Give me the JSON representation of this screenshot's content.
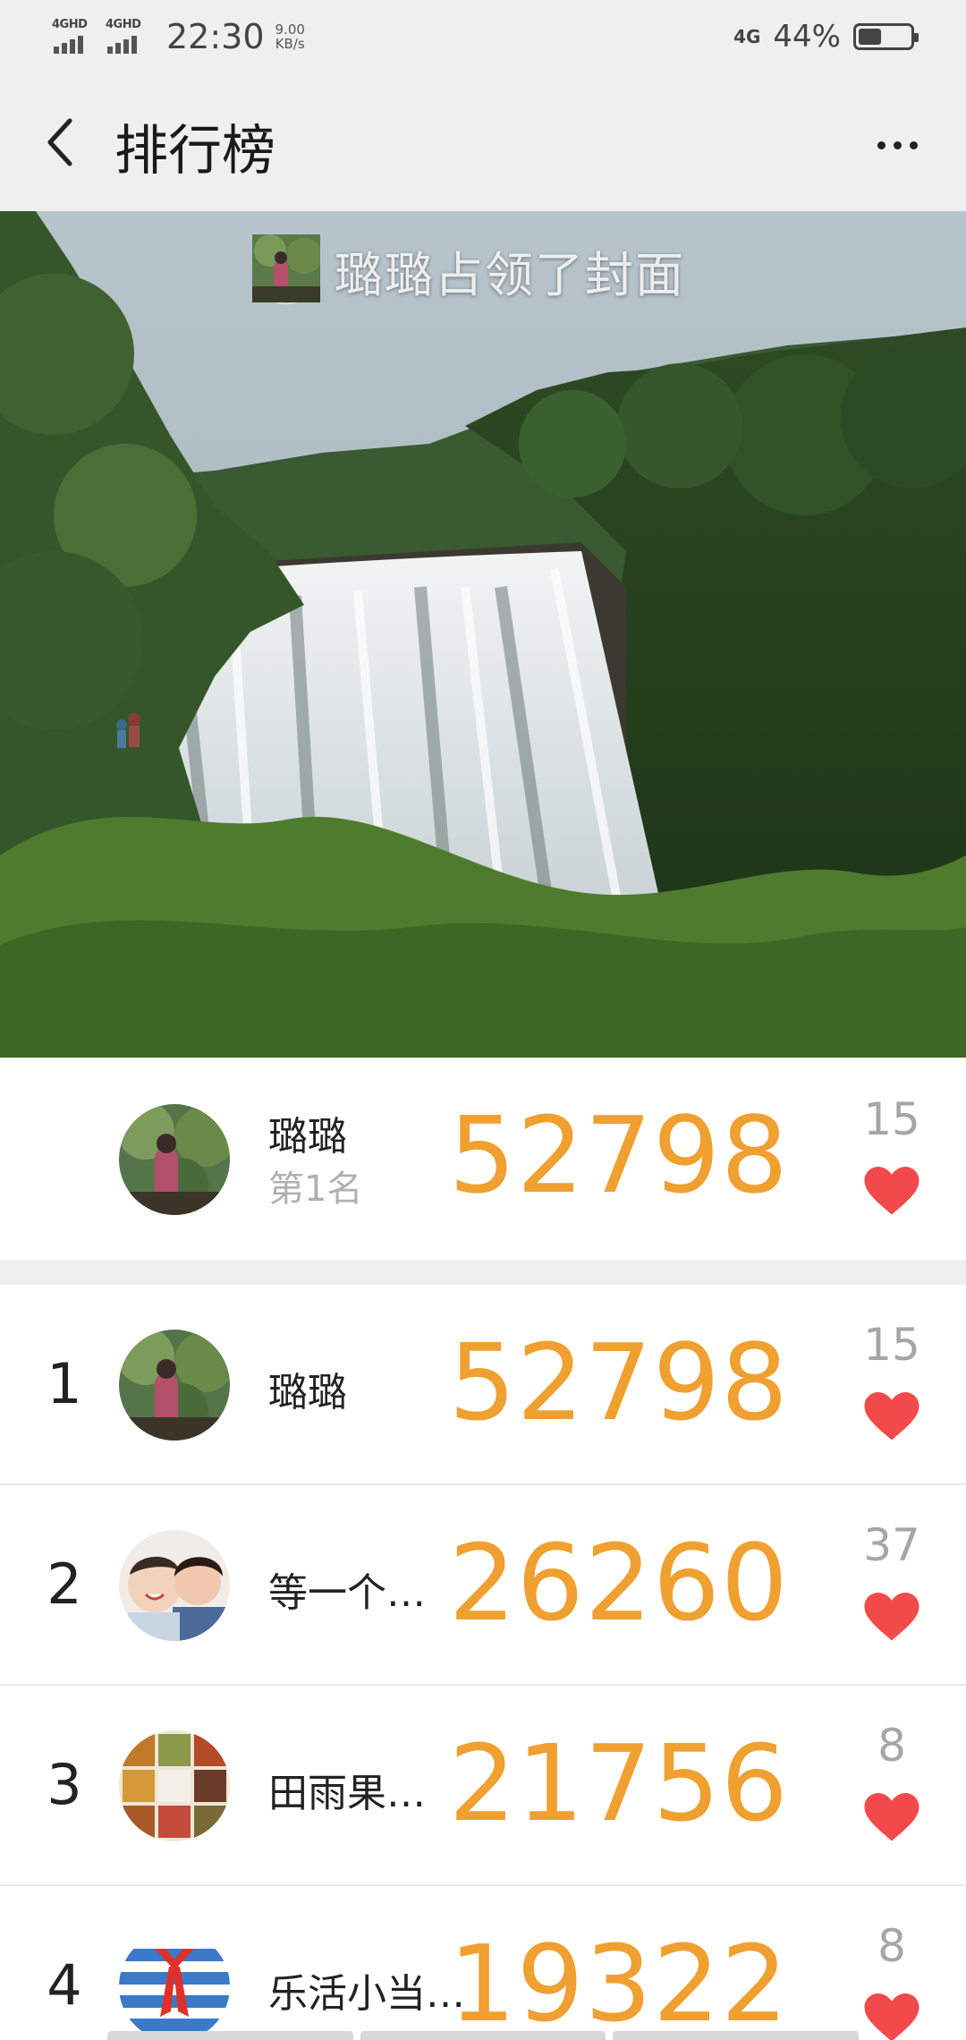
{
  "status_bar": {
    "net1_label": "4GHD",
    "net2_label": "4GHD",
    "time": "22:30",
    "speed_value": "9.00",
    "speed_unit": "KB/s",
    "net_type": "4G",
    "battery_percent_label": "44%",
    "battery_level": 0.44
  },
  "header": {
    "title": "排行榜",
    "back_icon": "chevron-left-icon",
    "more_icon": "more-horizontal-icon"
  },
  "banner": {
    "cover_text": "璐璐占领了封面"
  },
  "my_rank": {
    "name": "璐璐",
    "rank_text": "第1名",
    "score": "52798",
    "likes": "15"
  },
  "ranking": [
    {
      "rank": "1",
      "name": "璐璐",
      "score": "52798",
      "likes": "15"
    },
    {
      "rank": "2",
      "name": "等一个…",
      "score": "26260",
      "likes": "37"
    },
    {
      "rank": "3",
      "name": "田雨果…",
      "score": "21756",
      "likes": "8"
    },
    {
      "rank": "4",
      "name": "乐活小当…",
      "score": "19322",
      "likes": "8"
    }
  ],
  "colors": {
    "score": "#f0a030",
    "heart": "#f24a4a",
    "bar_bg": "#efefef"
  }
}
